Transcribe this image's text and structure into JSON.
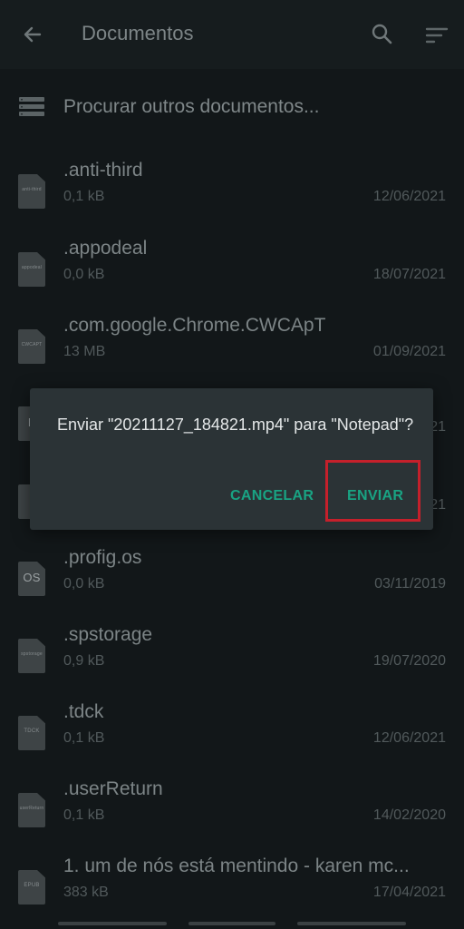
{
  "appbar": {
    "title": "Documentos",
    "back_icon": "arrow-left-icon",
    "search_icon": "search-icon",
    "sort_icon": "sort-icon"
  },
  "browse": {
    "label": "Procurar outros documentos..."
  },
  "files": [
    {
      "name": ".anti-third",
      "size": "0,1 kB",
      "date": "12/06/2021",
      "icon": "generic"
    },
    {
      "name": ".appodeal",
      "size": "0,0 kB",
      "date": "18/07/2021",
      "icon": "generic"
    },
    {
      "name": ".com.google.Chrome.CWCApT",
      "size": "13 MB",
      "date": "01/09/2021",
      "icon": "generic"
    },
    {
      "name": "",
      "size": "",
      "date": "21",
      "icon_label": "F"
    },
    {
      "name": "",
      "size": "",
      "date": "21",
      "icon": "generic"
    },
    {
      "name": ".profig.os",
      "size": "0,0 kB",
      "date": "03/11/2019",
      "icon_label": "OS"
    },
    {
      "name": ".spstorage",
      "size": "0,9 kB",
      "date": "19/07/2020",
      "icon": "generic"
    },
    {
      "name": ".tdck",
      "size": "0,1 kB",
      "date": "12/06/2021",
      "icon_label": "TDCK"
    },
    {
      "name": ".userReturn",
      "size": "0,1 kB",
      "date": "14/02/2020",
      "icon": "generic"
    },
    {
      "name": "1. um de nós está mentindo - karen mc...",
      "size": "383 kB",
      "date": "17/04/2021",
      "icon_label": "EPUB"
    }
  ],
  "dialog": {
    "message": "Enviar \"20211127_184821.mp4\" para \"Notepad\"?",
    "cancel_label": "CANCELAR",
    "send_label": "ENVIAR"
  },
  "colors": {
    "accent": "#19a383",
    "highlight": "#c5202b",
    "background": "#121719",
    "dialog": "#2b3336"
  }
}
